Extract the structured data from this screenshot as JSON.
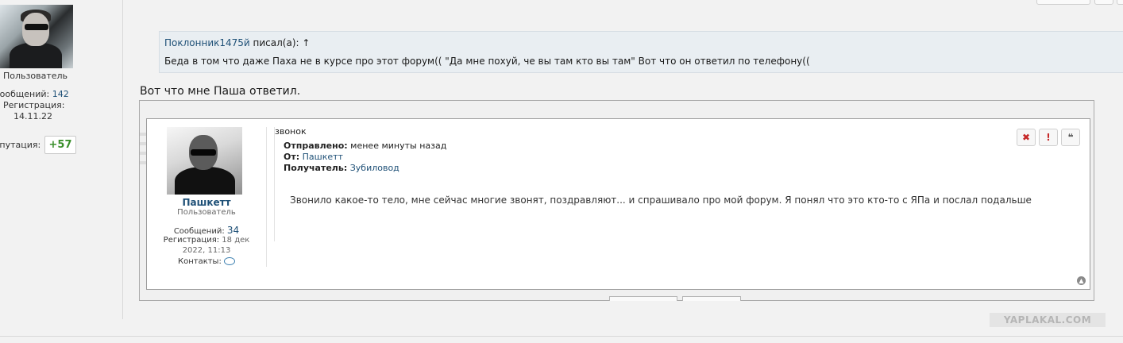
{
  "left_profile": {
    "role": "Пользователь",
    "messages_label": "Сообщений:",
    "messages_value": "142",
    "registration_label": "Регистрация:",
    "registration_value": "14.11.22",
    "reputation_label": "Репутация:",
    "reputation_value": "+57"
  },
  "quote": {
    "author": "Поклонник1475й",
    "wrote": " писал(а):",
    "arrow": "↑",
    "text": "Беда в том что даже Паха не в курсе про этот форум(( \"Да мне похуй, че вы там кто вы там\" Вот что он ответил по телефону(("
  },
  "post_text": "Вот что мне Паша ответил.",
  "screenshot": {
    "username": "Пашкетт",
    "role": "Пользователь",
    "messages_label": "Сообщений:",
    "messages_value": "34",
    "registration_label": "Регистрация:",
    "registration_value": "18 дек",
    "registration_value2": "2022, 11:13",
    "contacts_label": "Контакты:",
    "contacts_icon": "speech-bubble-icon",
    "subject": "звонок",
    "sent_label": "Отправлено:",
    "sent_value": "менее минуты назад",
    "from_label": "От:",
    "from_value": "Пашкетт",
    "to_label": "Получатель:",
    "to_value": "Зубиловод",
    "body": "Звонило какое-то тело, мне сейчас многие звонят, поздравляют... и спрашивало про мой форум. Я понял что это кто-то с ЯПа и послал подальше",
    "delete_glyph": "✖",
    "report_glyph": "!",
    "quote_glyph": "❝",
    "scroll_top_glyph": "▲"
  },
  "watermark": "YAPLAKAL.COM",
  "colors": {
    "link": "#1d4f76",
    "reputation": "#3a8f2b",
    "delete": "#c62828",
    "quote_bg": "#e9eef2"
  }
}
